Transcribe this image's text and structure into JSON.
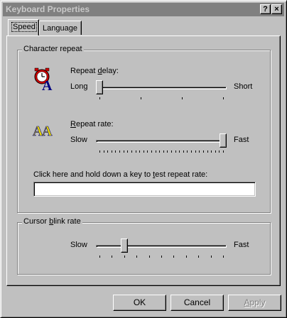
{
  "window": {
    "title": "Keyboard Properties"
  },
  "titlebar_buttons": {
    "help": "?",
    "close": "×"
  },
  "tabs": [
    {
      "label": "Speed",
      "active": true
    },
    {
      "label": "Language",
      "active": false
    }
  ],
  "character_repeat": {
    "legend": "Character repeat",
    "repeat_delay": {
      "label_pre": "Repeat ",
      "label_hotkey": "d",
      "label_post": "elay:",
      "min_label": "Long",
      "max_label": "Short",
      "value_fraction": 0.0,
      "tick_count": 4
    },
    "repeat_rate": {
      "label_pre": "",
      "label_hotkey": "R",
      "label_post": "epeat rate:",
      "min_label": "Slow",
      "max_label": "Fast",
      "value_fraction": 1.0,
      "tick_count": 32
    },
    "test_prompt_pre": "Click here and hold down a key to ",
    "test_prompt_hotkey": "t",
    "test_prompt_post": "est repeat rate:",
    "test_input_value": ""
  },
  "cursor_blink": {
    "legend_pre": "Cursor ",
    "legend_hotkey": "b",
    "legend_post": "link rate",
    "min_label": "Slow",
    "max_label": "Fast",
    "value_fraction": 0.2,
    "tick_count": 11
  },
  "buttons": {
    "ok": "OK",
    "cancel": "Cancel",
    "apply_pre": "",
    "apply_hotkey": "A",
    "apply_post": "pply"
  },
  "colors": {
    "face": "#c0c0c0",
    "titlebar_inactive": "#808080",
    "clock_red": "#cc0000",
    "letter_blue": "#000080",
    "letter_yellow": "#e8d800"
  }
}
